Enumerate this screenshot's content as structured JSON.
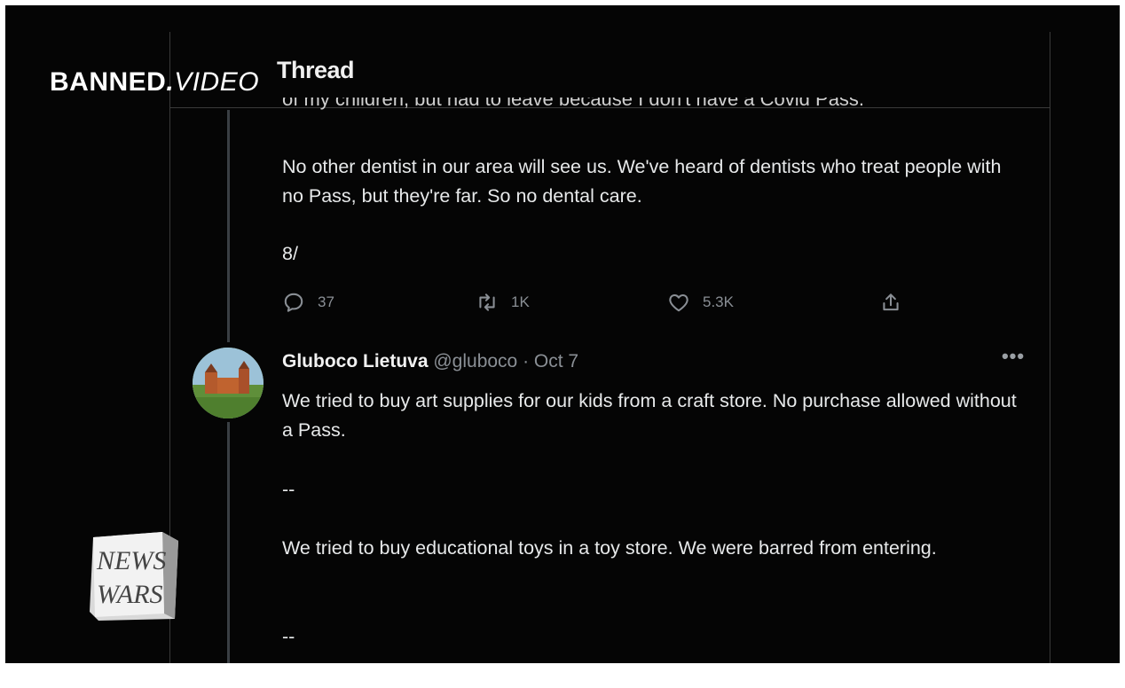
{
  "overlay": {
    "brand_banned": "BANNED",
    "brand_video": "VIDEO"
  },
  "header": {
    "title": "Thread",
    "cut_off_text": "of my children, but had to leave because I don't have a Covid Pass."
  },
  "tweet1": {
    "paragraph1": "No other dentist in our area will see us. We've heard of dentists who treat people with no Pass, but they're far. So no dental care.",
    "counter": "8/",
    "actions": {
      "reply_count": "37",
      "retweet_count": "1K",
      "like_count": "5.3K"
    }
  },
  "tweet2": {
    "author_name": "Gluboco Lietuva",
    "author_meta": "@gluboco · Oct 7",
    "more_label": "•••",
    "paragraph1": "We tried to buy art supplies for our kids from a craft store. No purchase allowed without a Pass.",
    "separator1": "--",
    "paragraph2": "We tried to buy educational toys in a toy store. We were barred from entering.",
    "separator2": "--"
  },
  "newswars_logo": {
    "line1": "NEWS",
    "line2": "WARS"
  }
}
